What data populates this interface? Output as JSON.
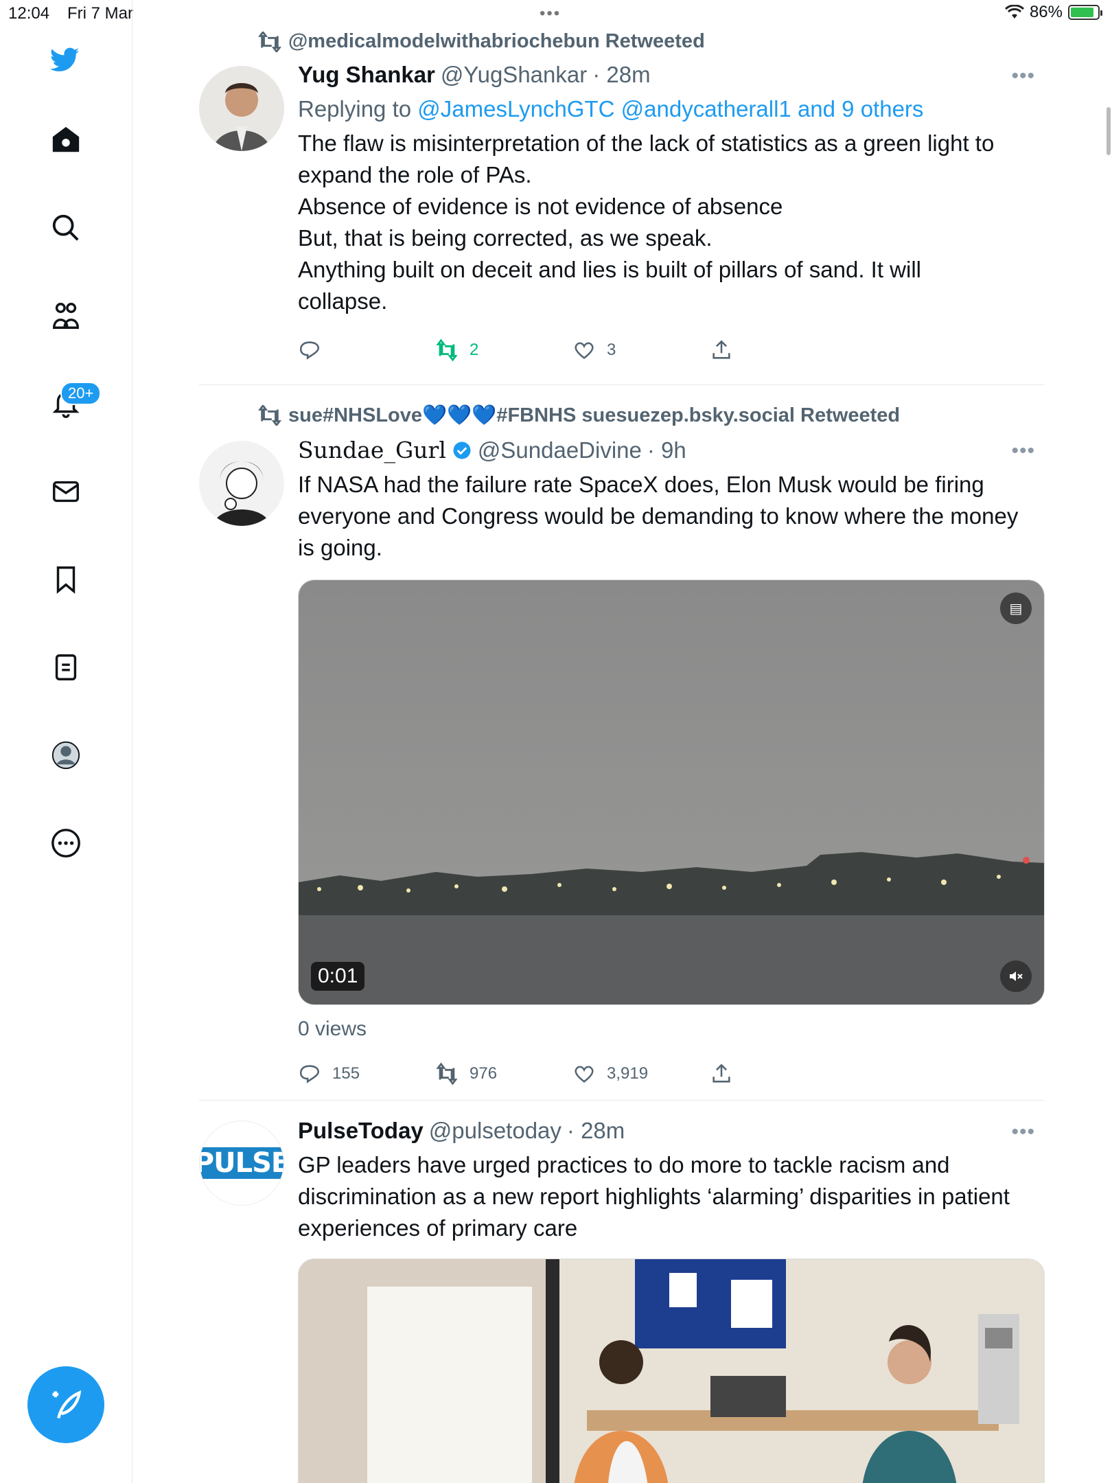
{
  "status_bar": {
    "time": "12:04",
    "date": "Fri 7 Mar",
    "battery": "86%"
  },
  "sidebar": {
    "notifications_badge": "20+"
  },
  "tweets": [
    {
      "retweeted_by": "@medicalmodelwithabriochebun Retweeted",
      "name": "Yug Shankar",
      "handle": "@YugShankar",
      "time": "· 28m",
      "replying_prefix": "Replying to",
      "replying_links": "@JamesLynchGTC @andycatherall1 and 9 others",
      "text_lines": [
        "The flaw is misinterpretation of the lack of statistics as a green light to",
        "expand the role of PAs.",
        "Absence of evidence is not evidence of absence",
        "But, that is being corrected, as we speak.",
        "Anything built on deceit and lies is built of pillars of sand. It will",
        "collapse."
      ],
      "replies": "",
      "retweets": "2",
      "likes": "3"
    },
    {
      "retweeted_by": "sue#NHSLove💙💙💙#FBNHS suesuezep.bsky.social Retweeted",
      "name": "Sundae_Gurl",
      "handle": "@SundaeDivine",
      "time": "· 9h",
      "text_lines": [
        "If NASA had the failure rate SpaceX does, Elon Musk would be firing",
        "everyone and Congress would be demanding to know where the money",
        "is going."
      ],
      "video_duration": "0:01",
      "views": "0 views",
      "replies": "155",
      "retweets": "976",
      "likes": "3,919"
    },
    {
      "name": "PulseToday",
      "handle": "@pulsetoday",
      "time": "· 28m",
      "avatar_text": "PULSE",
      "text_lines": [
        "GP leaders have urged practices to do more to tackle racism and",
        "discrimination as a new report highlights ‘alarming’ disparities in patient",
        "experiences of primary care"
      ]
    }
  ],
  "colors": {
    "accent": "#1d9bf0",
    "retweet_green": "#00ba7c",
    "secondary": "#536471"
  }
}
